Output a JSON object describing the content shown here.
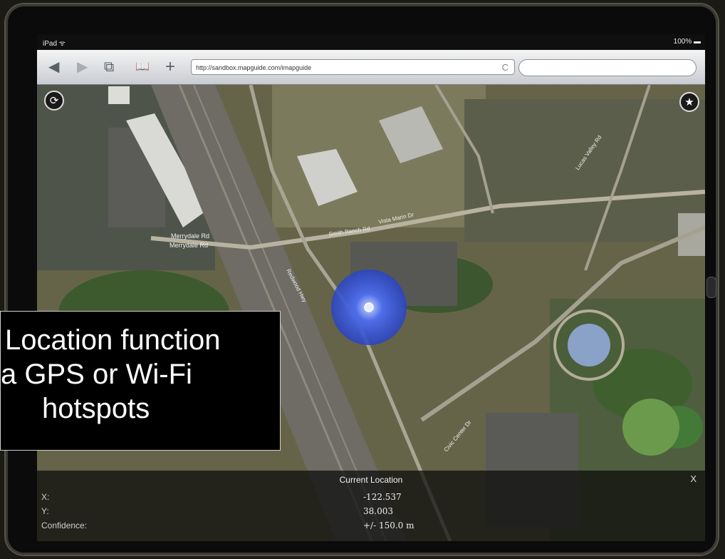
{
  "status": {
    "carrier": "iPad ᯤ",
    "battery": "100% ▬"
  },
  "toolbar": {
    "back": "◀",
    "forward": "▶",
    "pages": "⧉",
    "bookmarks": "📖",
    "add": "+",
    "url": "http://sandbox.mapguide.com/imapguide",
    "reload": "C",
    "search_placeholder": ""
  },
  "map": {
    "roads": [
      "Merrydale Rd",
      "Merrydale Rd",
      "Smith Ranch Rd",
      "Vista Marin Dr",
      "Civic Center Dr",
      "Lucas Valley Rd",
      "Redwood Hwy"
    ],
    "locate_icon": "⟳",
    "favorite_icon": "★"
  },
  "callout": {
    "line1": "Location function",
    "line2": "a GPS or Wi-Fi",
    "line3": "hotspots"
  },
  "location_panel": {
    "title": "Current Location",
    "close": "X",
    "x_label": "X:",
    "y_label": "Y:",
    "confidence_label": "Confidence:",
    "x_value": "-122.537",
    "y_value": "38.003",
    "confidence_value": "+/- 150.0 m"
  }
}
